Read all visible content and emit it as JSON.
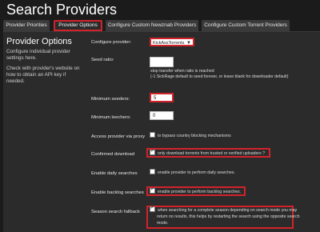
{
  "page": {
    "title": "Search Providers"
  },
  "tabs": [
    {
      "label": "Provider Priorities",
      "active": false
    },
    {
      "label": "Provider Options",
      "active": true
    },
    {
      "label": "Configure Custom Newznab Providers",
      "active": false
    },
    {
      "label": "Configure Custom Torrent Providers",
      "active": false
    }
  ],
  "left": {
    "title": "Provider Options",
    "text1": "Configure individual provider settings here.",
    "text2": "Check with provider's website on how to obtain an API key if needed."
  },
  "form": {
    "configure_provider": {
      "label": "Configure provider:",
      "value": "KickAssTorrents"
    },
    "seed_ratio": {
      "label": "Seed ratio:",
      "value": "",
      "note1": "stop transfer when ratio is reached",
      "note2": "(-1 SickRage default to seed forever, or leave blank for downloader default)"
    },
    "minimum_seeders": {
      "label": "Minimum seeders:",
      "value": "5"
    },
    "minimum_leechers": {
      "label": "Minimum leechers:",
      "value": "0"
    },
    "access_provider_via_proxy": {
      "label": "Access provider via proxy",
      "checkbox_label": "to bypass country blocking mechanisms",
      "checked": false
    },
    "confirmed_download": {
      "label": "Confirmed download",
      "checkbox_label": "only download torrents from trusted or verified uploaders ?",
      "checked": true
    },
    "enable_daily_searches": {
      "label": "Enable daily searches",
      "checkbox_label": "enable provider to perform daily searches.",
      "checked": false
    },
    "enable_backlog_searches": {
      "label": "Enable backlog searches",
      "checkbox_label": "enable provider to perform backlog searches.",
      "checked": true
    },
    "season_search_fallback": {
      "label": "Season search fallback",
      "checkbox_label_line1": "when searching for a complete season depending on search mode you may",
      "checkbox_label_line2": "return no results, this helps by restarting the search using the opposite search",
      "checkbox_label_line3": "mode.",
      "checked": true
    }
  },
  "colors": {
    "background": "#1b1b1b",
    "panel": "#2b2b2b",
    "tab": "#3a3a3a",
    "highlight": "#d2232a"
  }
}
